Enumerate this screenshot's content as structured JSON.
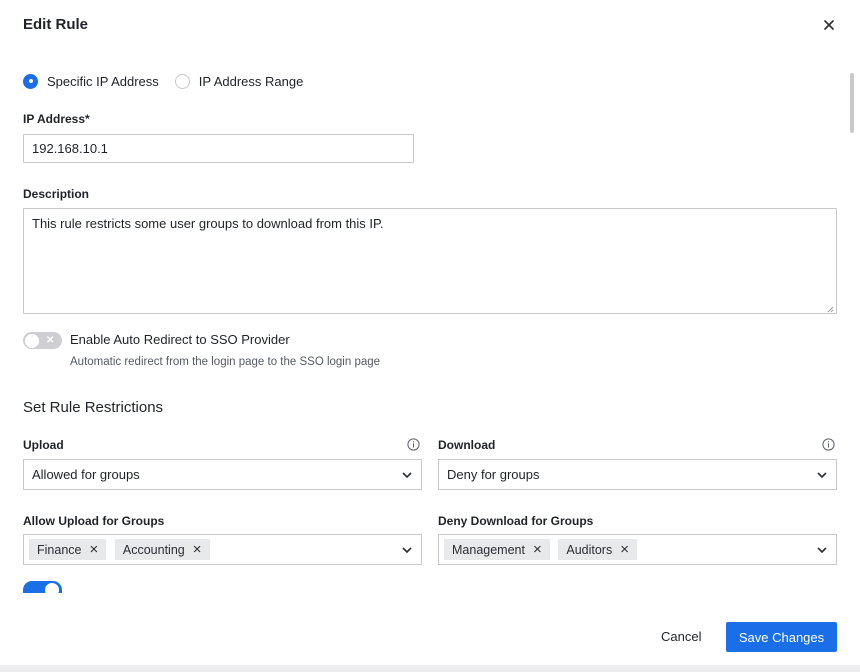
{
  "dialog": {
    "title": "Edit Rule",
    "close_icon": "close-icon"
  },
  "ip_type": {
    "options": [
      {
        "label": "Specific IP Address",
        "checked": true
      },
      {
        "label": "IP Address Range",
        "checked": false
      }
    ]
  },
  "ip_address": {
    "label": "IP Address*",
    "value": "192.168.10.1"
  },
  "description": {
    "label": "Description",
    "value": "This rule restricts some user groups to download from this IP."
  },
  "sso_toggle": {
    "enabled": false,
    "label": "Enable Auto Redirect to SSO Provider",
    "help": "Automatic redirect from the login page to the SSO login page"
  },
  "restrictions": {
    "title": "Set Rule Restrictions",
    "upload": {
      "label": "Upload",
      "value": "Allowed for groups",
      "groups_label": "Allow Upload for Groups",
      "groups": [
        "Finance",
        "Accounting"
      ]
    },
    "download": {
      "label": "Download",
      "value": "Deny for groups",
      "groups_label": "Deny Download for Groups",
      "groups": [
        "Management",
        "Auditors"
      ]
    }
  },
  "footer": {
    "cancel_label": "Cancel",
    "save_label": "Save Changes"
  },
  "colors": {
    "accent": "#1a6fe8",
    "chip_bg": "#e8e9eb",
    "border": "#c8c8c8"
  }
}
